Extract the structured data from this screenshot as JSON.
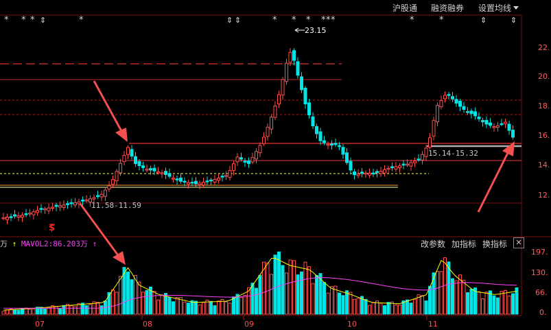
{
  "toolbar": {
    "shanghai_connect": "沪股通",
    "margin_trading": "融资融券",
    "set_ma": "设置均线"
  },
  "price_axis": {
    "ticks": [
      "22.",
      "20.",
      "18.",
      "16.",
      "14.",
      "12."
    ]
  },
  "price_annotations": {
    "high_label": "23.15",
    "left_range": "11.58-11.59",
    "right_range": "15.14-15.32",
    "flag_symbol": "$"
  },
  "event_markers": {
    "stars": [
      "*",
      "*",
      "*",
      "*",
      "*",
      "*",
      "*",
      "*",
      "*",
      "*",
      "*",
      "*",
      "*",
      "*",
      "*"
    ],
    "updowns": [
      "⇕",
      "⇕",
      "⇕",
      "⇕",
      "⇕",
      "⇕"
    ]
  },
  "volume_panel": {
    "unit_fragment": "万",
    "ma_label": "MAVOL2:86.203万",
    "ma_arrow": "↑",
    "yellow_arrow": "↑",
    "axis_ticks": [
      "197.",
      "130.",
      "66.",
      "0."
    ],
    "buttons": {
      "change_params": "改参数",
      "add_indicator": "加指标",
      "switch_indicator": "换指标",
      "close": "✕"
    }
  },
  "time_axis": {
    "labels": [
      "07",
      "08",
      "09",
      "10",
      "11"
    ]
  },
  "colors": {
    "up": "#ff5050",
    "down": "#00e5e5",
    "yellow": "#ffff00",
    "magenta": "#ff40ff",
    "arrow": "#f55050"
  }
}
